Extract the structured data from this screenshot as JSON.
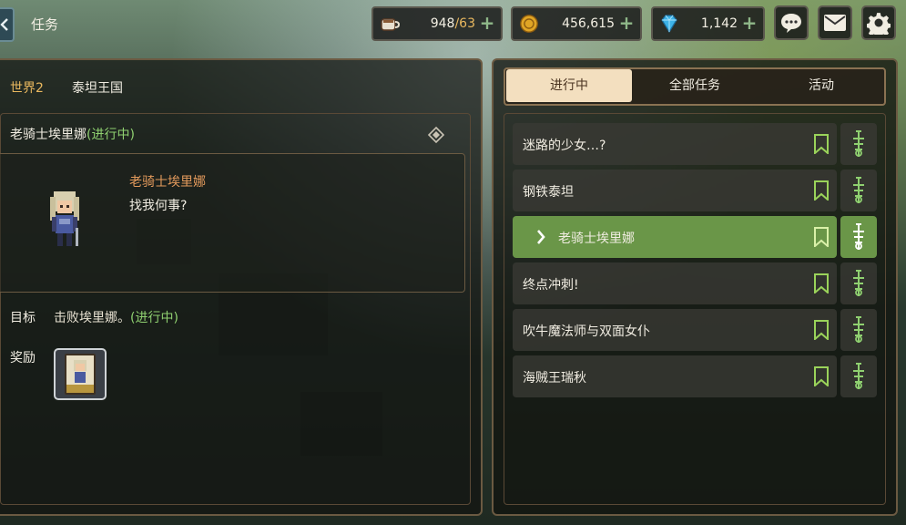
{
  "header": {
    "title": "任务",
    "stamina": {
      "value": "948",
      "max": "/63",
      "icon": "coffee-cup-icon"
    },
    "gold": {
      "value": "456,615",
      "icon": "gold-coin-icon"
    },
    "gems": {
      "value": "1,142",
      "icon": "diamond-icon"
    },
    "buttons": [
      "chat-icon",
      "mail-icon",
      "settings-icon"
    ]
  },
  "location": {
    "world": "世界2",
    "realm": "泰坦王国"
  },
  "quest": {
    "title": "老骑士埃里娜",
    "status": "(进行中)",
    "npc_name": "老骑士埃里娜",
    "npc_line": "找我何事?",
    "goal_label": "目标",
    "goal_text": "击败埃里娜。",
    "goal_status": "(进行中)",
    "reward_label": "奖励"
  },
  "tabs": [
    {
      "label": "进行中",
      "active": true
    },
    {
      "label": "全部任务",
      "active": false
    },
    {
      "label": "活动",
      "active": false
    }
  ],
  "quests": [
    {
      "label": "迷路的少女…?",
      "active": false
    },
    {
      "label": "钢铁泰坦",
      "active": false
    },
    {
      "label": "老骑士埃里娜",
      "active": true
    },
    {
      "label": "终点冲刺!",
      "active": false
    },
    {
      "label": "吹牛魔法师与双面女仆",
      "active": false
    },
    {
      "label": "海贼王瑞秋",
      "active": false
    }
  ],
  "colors": {
    "accent_green": "#6a9648",
    "status_green": "#8fd070",
    "world_gold": "#e9b85f",
    "npc_name_orange": "#e39a5c",
    "panel_border": "#6b5a42"
  }
}
